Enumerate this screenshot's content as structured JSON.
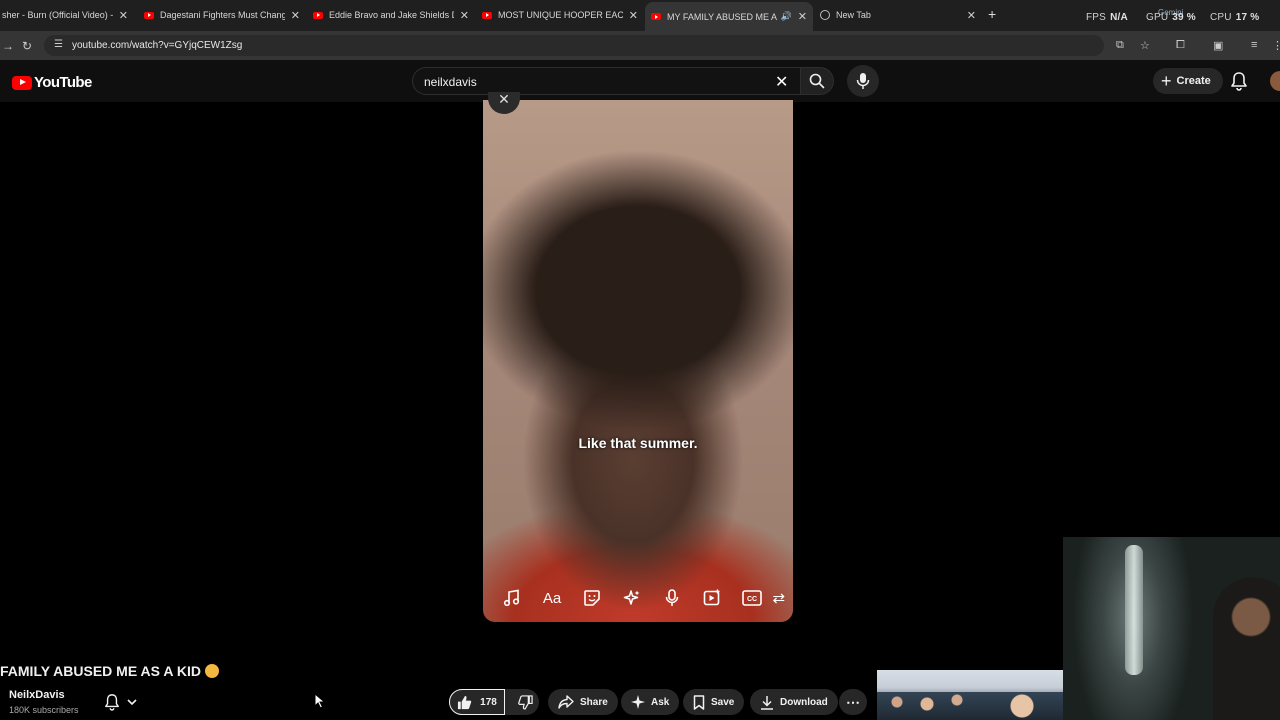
{
  "browser": {
    "tabs": [
      {
        "title": "sher - Burn (Official Video) - Y",
        "active": false,
        "favicon": "youtube-icon"
      },
      {
        "title": "Dagestani Fighters Must Chang",
        "active": false,
        "favicon": "youtube-icon"
      },
      {
        "title": "Eddie Bravo and Jake Shields D",
        "active": false,
        "favicon": "youtube-icon"
      },
      {
        "title": "MOST UNIQUE HOOPER EACH",
        "active": false,
        "favicon": "youtube-icon"
      },
      {
        "title": "MY FAMILY ABUSED ME AS",
        "active": true,
        "favicon": "youtube-icon"
      },
      {
        "title": "New Tab",
        "active": false,
        "favicon": "globe-icon"
      }
    ],
    "url": "youtube.com/watch?v=GYjqCEW1Zsg",
    "overlay": {
      "fps_label": "FPS",
      "fps_value": "N/A",
      "gpu_label": "GPU",
      "gpu_value": "39 %",
      "cpu_label": "CPU",
      "cpu_value": "17 %",
      "gemini": "Gemini"
    }
  },
  "youtube": {
    "logo_text": "YouTube",
    "search_query": "neilxdavis",
    "create_label": "Create"
  },
  "video": {
    "caption": "Like that summer.",
    "editor_tools": [
      "music-icon",
      "text-icon",
      "sticker-icon",
      "effects-icon",
      "voiceover-icon",
      "add-clip-icon",
      "captions-icon",
      "more-icon"
    ]
  },
  "details": {
    "title": "FAMILY ABUSED ME AS A KID",
    "channel_name": "NeilxDavis",
    "subscribers": "180K subscribers",
    "like_count": "178",
    "share_label": "Share",
    "ask_label": "Ask",
    "save_label": "Save",
    "download_label": "Download"
  }
}
